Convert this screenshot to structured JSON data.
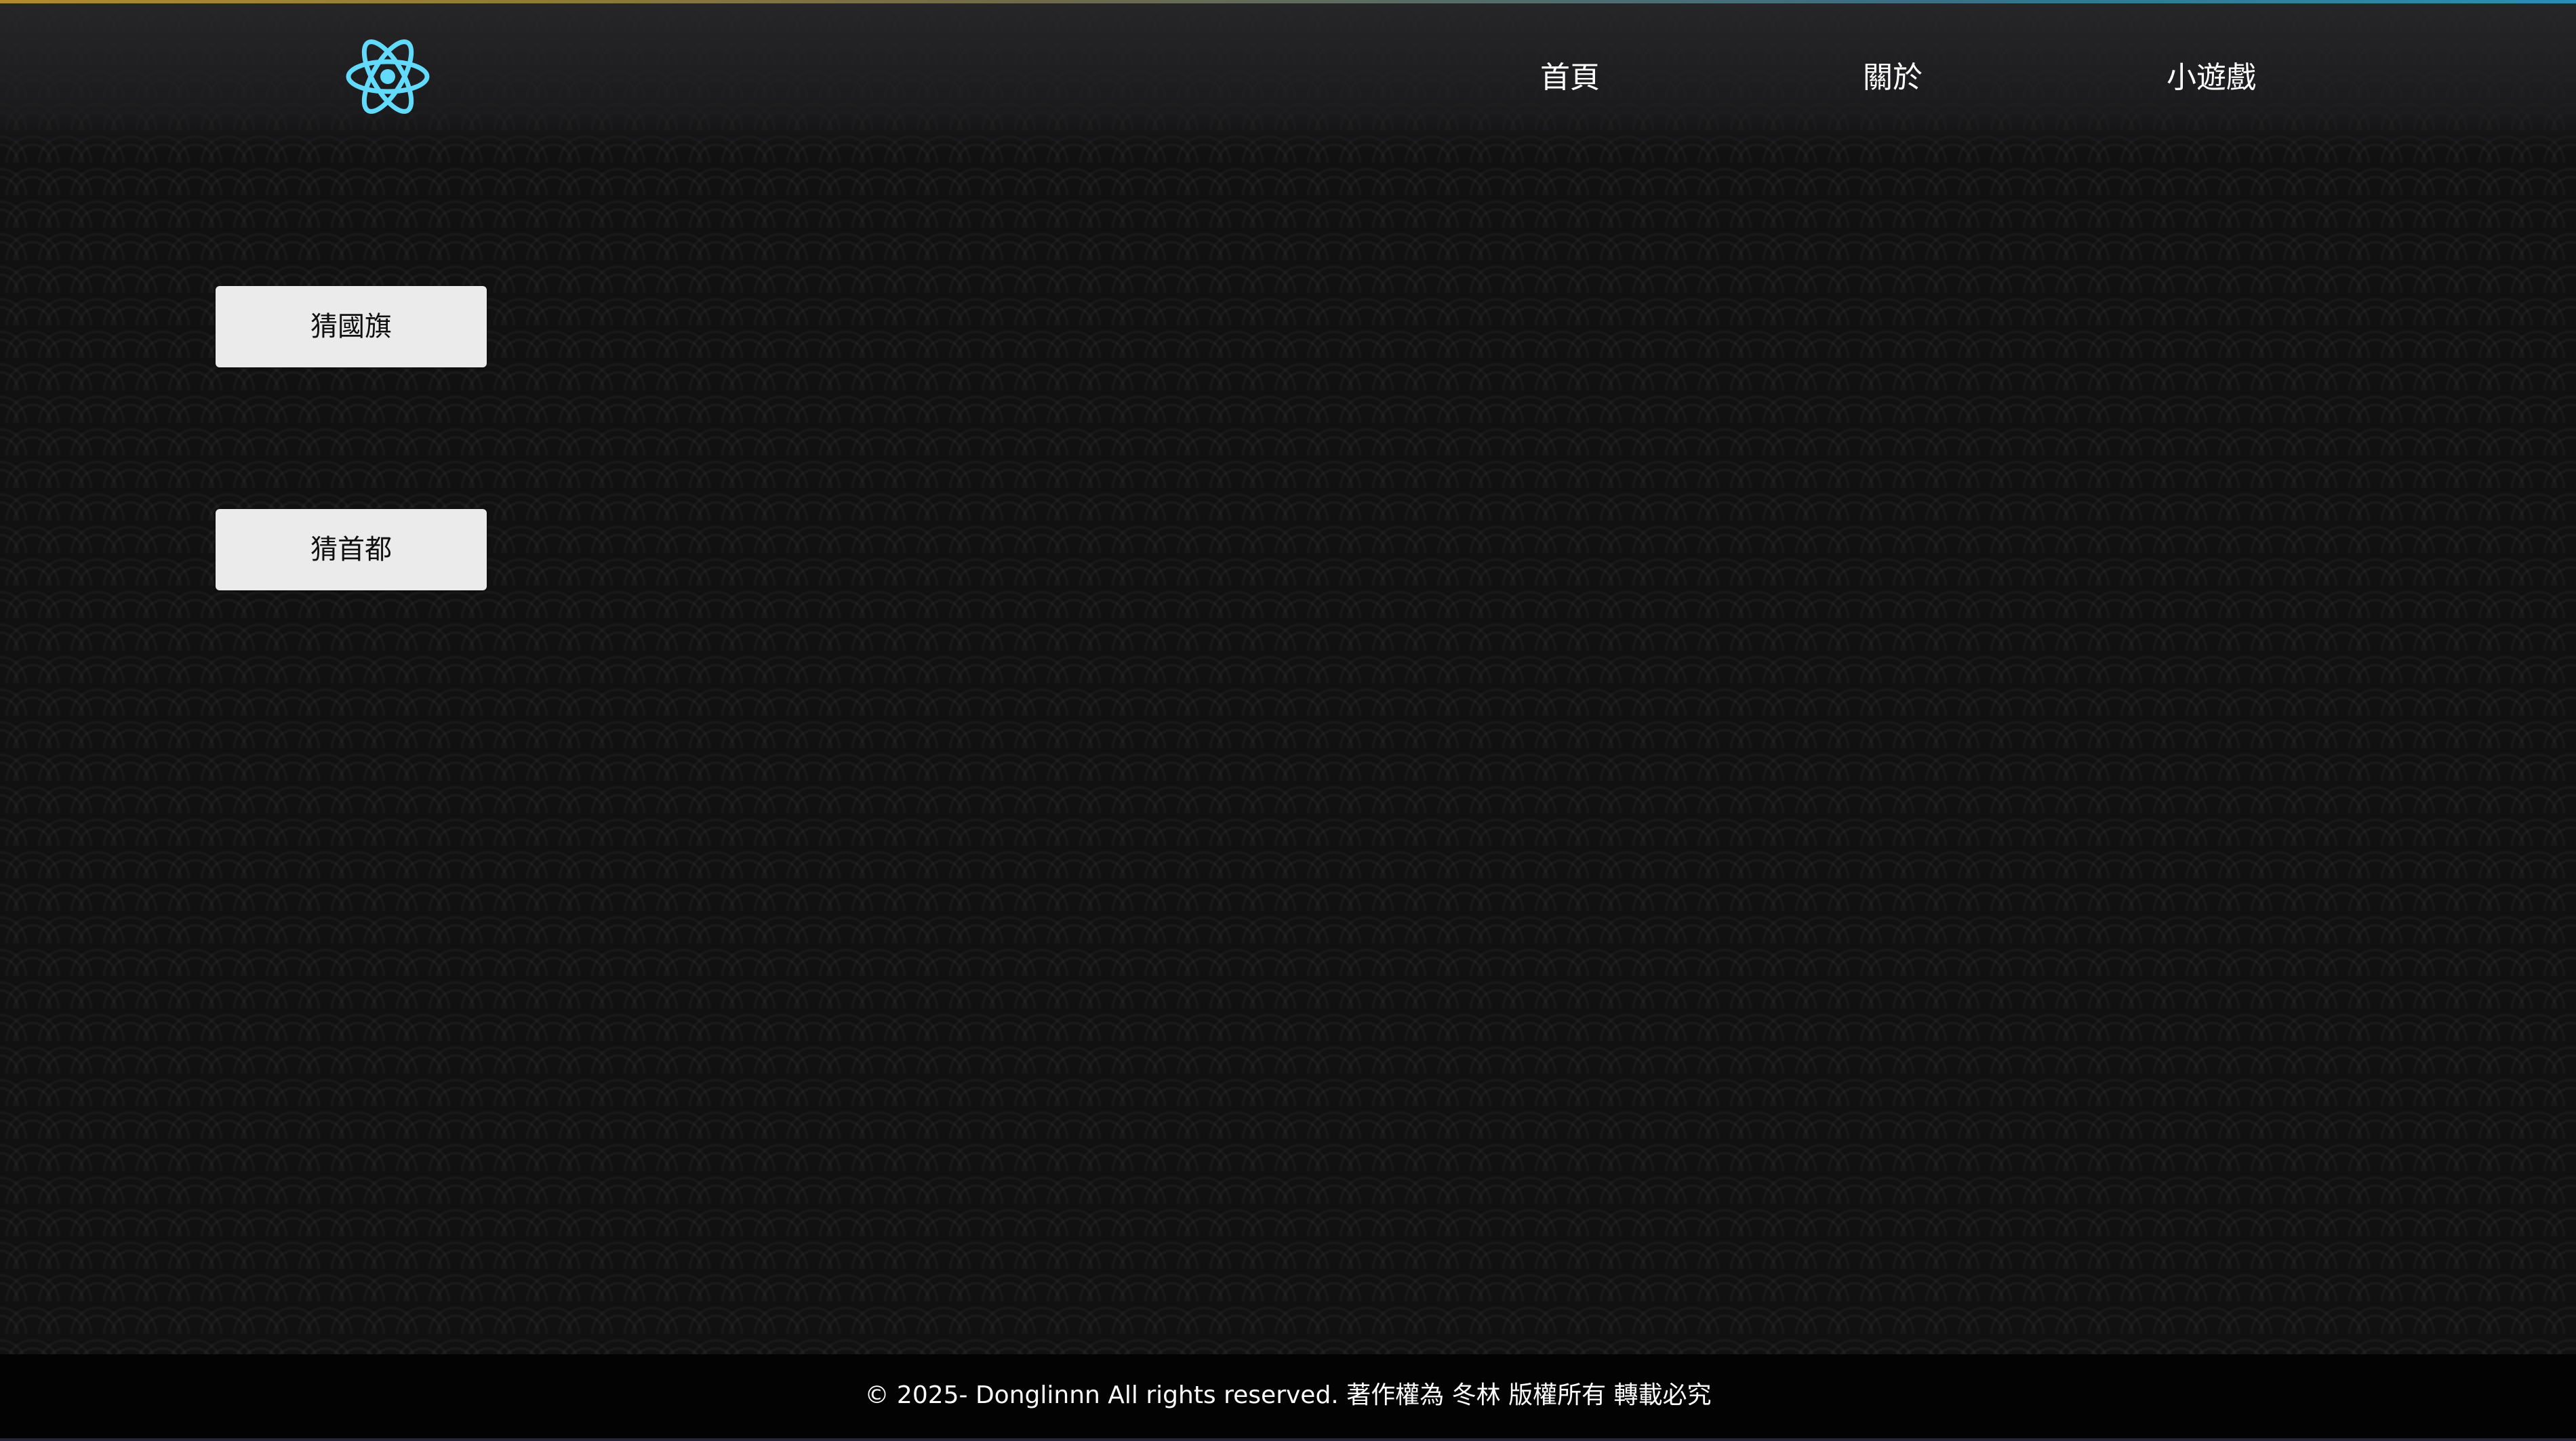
{
  "header": {
    "logo_icon": "react-atom-icon",
    "logo_color": "#61dafb",
    "nav": [
      {
        "label": "首頁"
      },
      {
        "label": "關於"
      },
      {
        "label": "小遊戲"
      }
    ]
  },
  "games": [
    {
      "label": "猜國旗"
    },
    {
      "label": "猜首都"
    }
  ],
  "footer": {
    "text": "© 2025- Donglinnn All rights reserved. 著作權為 冬林 版權所有 轉載必究"
  }
}
